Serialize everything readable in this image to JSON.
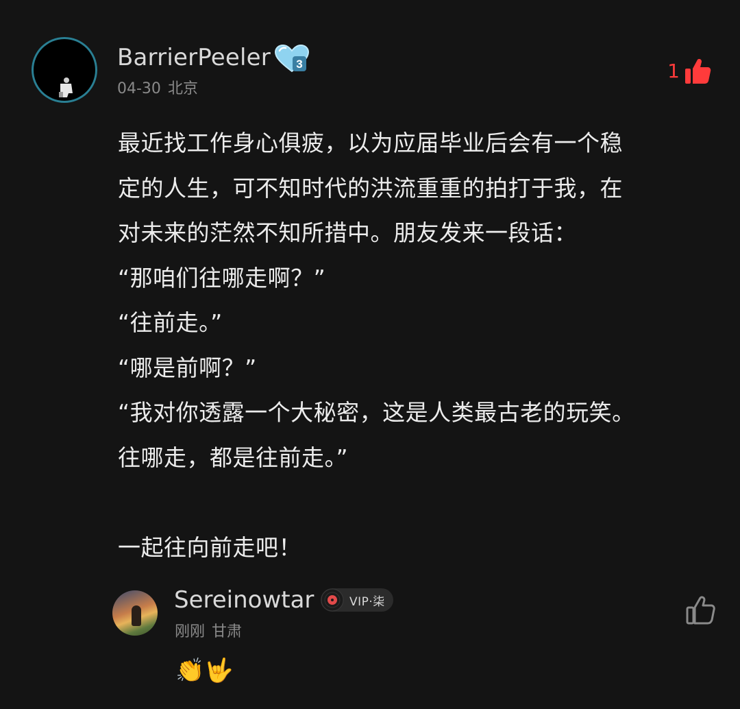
{
  "comment": {
    "username": "BarrierPeeler",
    "level_badge": "3",
    "date": "04-30",
    "location": "北京",
    "like_count": "1",
    "like_icon": "thumbs-up-filled-icon",
    "like_color": "#ff3b3b",
    "paragraphs": [
      "最近找工作身心俱疲，以为应届毕业后会有一个稳",
      "定的人生，可不知时代的洪流重重的拍打于我，在",
      "对未来的茫然不知所措中。朋友发来一段话：",
      "“那咱们往哪走啊？”",
      "“往前走。”",
      "“哪是前啊？”",
      "“我对你透露一个大秘密，这是人类最古老的玩笑。",
      "往哪走，都是往前走。”",
      "",
      "一起往向前走吧！"
    ]
  },
  "reply": {
    "username": "Sereinowtar",
    "vip_badge": "VIP·柒",
    "time": "刚刚",
    "location": "甘肃",
    "emoji": "👏🤟",
    "like_icon": "thumbs-up-outline-icon"
  }
}
